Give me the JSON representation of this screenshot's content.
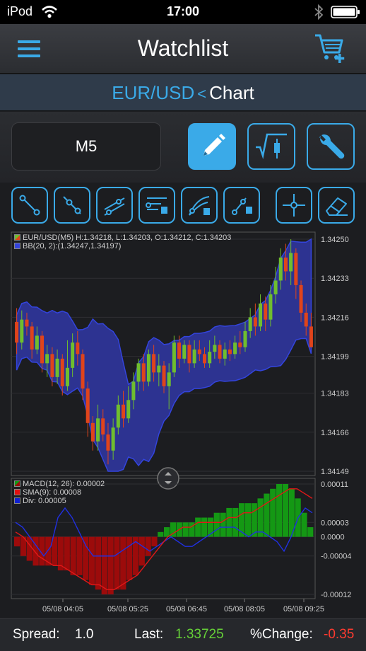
{
  "status": {
    "carrier": "iPod",
    "time": "17:00"
  },
  "nav": {
    "title": "Watchlist"
  },
  "subnav": {
    "symbol": "EUR/USD",
    "separator": "<",
    "page": "Chart"
  },
  "toolbar": {
    "timeframe": "M5"
  },
  "colors": {
    "accent": "#3aaae8",
    "bullish": "#6fbe2e",
    "bearish": "#e0441b",
    "band": "#2d3391",
    "band_edge": "#3344dd",
    "macd_bar_up": "#149814",
    "macd_bar_down": "#9c0b0b",
    "positive": "#66d138",
    "negative": "#ff3b30"
  },
  "icons": [
    "menu-icon",
    "cart-add-icon",
    "pencil-icon",
    "indicator-icon",
    "wrench-icon",
    "line-segment-icon",
    "ray-icon",
    "channel-icon",
    "fibonacci-retracement-icon",
    "fibonacci-fan-icon",
    "fibonacci-extension-icon",
    "crosshair-icon",
    "eraser-icon"
  ],
  "chart_data": [
    {
      "type": "candlestick",
      "legend": [
        "EUR/USD(M5) H:1.34218, L:1.34203, O:1.34212, C:1.34203",
        "BB(20, 2):(1.34247,1.34197)"
      ],
      "y_ticks": [
        "1.34250",
        "1.34233",
        "1.34216",
        "1.34199",
        "1.34183",
        "1.34166",
        "1.34149"
      ],
      "ylim": [
        1.34149,
        1.3425
      ],
      "candles": [
        [
          1.34214,
          1.34205,
          1.3422,
          1.342
        ],
        [
          1.34205,
          1.34215,
          1.34219,
          1.34202
        ],
        [
          1.34215,
          1.34212,
          1.34218,
          1.34208
        ],
        [
          1.34212,
          1.34202,
          1.34214,
          1.34198
        ],
        [
          1.34202,
          1.34208,
          1.34212,
          1.342
        ],
        [
          1.34208,
          1.34196,
          1.3421,
          1.34192
        ],
        [
          1.34196,
          1.342,
          1.34204,
          1.3419
        ],
        [
          1.342,
          1.3419,
          1.34203,
          1.34186
        ],
        [
          1.3419,
          1.34198,
          1.34202,
          1.34187
        ],
        [
          1.34198,
          1.34186,
          1.342,
          1.34182
        ],
        [
          1.34186,
          1.34194,
          1.34206,
          1.34184
        ],
        [
          1.34194,
          1.34205,
          1.34209,
          1.3419
        ],
        [
          1.34205,
          1.342,
          1.3421,
          1.34195
        ],
        [
          1.342,
          1.34185,
          1.34202,
          1.3418
        ],
        [
          1.34185,
          1.3417,
          1.34188,
          1.34164
        ],
        [
          1.3417,
          1.34162,
          1.34173,
          1.34158
        ],
        [
          1.34162,
          1.34172,
          1.34178,
          1.34158
        ],
        [
          1.34172,
          1.34165,
          1.34176,
          1.34162
        ],
        [
          1.34165,
          1.34158,
          1.3417,
          1.34152
        ],
        [
          1.34158,
          1.34168,
          1.34172,
          1.34154
        ],
        [
          1.34168,
          1.34178,
          1.34182,
          1.34165
        ],
        [
          1.34178,
          1.34172,
          1.34184,
          1.34168
        ],
        [
          1.34172,
          1.3418,
          1.34186,
          1.3417
        ],
        [
          1.3418,
          1.34188,
          1.34192,
          1.34176
        ],
        [
          1.34188,
          1.34196,
          1.34198,
          1.34184
        ],
        [
          1.34196,
          1.34188,
          1.342,
          1.34184
        ],
        [
          1.34188,
          1.342,
          1.34202,
          1.34186
        ],
        [
          1.342,
          1.34192,
          1.34204,
          1.34188
        ],
        [
          1.34192,
          1.34195,
          1.342,
          1.34186
        ],
        [
          1.34195,
          1.34186,
          1.34197,
          1.34183
        ],
        [
          1.34186,
          1.34192,
          1.34196,
          1.34176
        ],
        [
          1.34192,
          1.34205,
          1.34208,
          1.3419
        ],
        [
          1.34205,
          1.34198,
          1.34208,
          1.34194
        ],
        [
          1.34198,
          1.34204,
          1.34206,
          1.34196
        ],
        [
          1.34204,
          1.34196,
          1.34206,
          1.34192
        ],
        [
          1.34196,
          1.34202,
          1.34206,
          1.34194
        ],
        [
          1.34202,
          1.342,
          1.34206,
          1.34197
        ],
        [
          1.342,
          1.34196,
          1.34203,
          1.34194
        ],
        [
          1.34196,
          1.34201,
          1.34206,
          1.34194
        ],
        [
          1.34201,
          1.34204,
          1.34208,
          1.34198
        ],
        [
          1.34204,
          1.34198,
          1.34206,
          1.34196
        ],
        [
          1.34198,
          1.34202,
          1.34205,
          1.34195
        ],
        [
          1.34202,
          1.342,
          1.34206,
          1.34197
        ],
        [
          1.342,
          1.34205,
          1.34208,
          1.34198
        ],
        [
          1.34205,
          1.34203,
          1.3421,
          1.342
        ],
        [
          1.34203,
          1.3421,
          1.34214,
          1.34201
        ],
        [
          1.3421,
          1.34216,
          1.3422,
          1.34207
        ],
        [
          1.34216,
          1.34212,
          1.34222,
          1.34208
        ],
        [
          1.34212,
          1.34222,
          1.34226,
          1.3421
        ],
        [
          1.34222,
          1.34215,
          1.34225,
          1.3421
        ],
        [
          1.34215,
          1.34226,
          1.3423,
          1.34212
        ],
        [
          1.34226,
          1.34232,
          1.34238,
          1.34222
        ],
        [
          1.34232,
          1.34242,
          1.34246,
          1.34228
        ],
        [
          1.34242,
          1.34236,
          1.34248,
          1.34232
        ],
        [
          1.34236,
          1.34244,
          1.3425,
          1.3423
        ],
        [
          1.34244,
          1.3423,
          1.34246,
          1.34224
        ],
        [
          1.3423,
          1.34218,
          1.34232,
          1.34214
        ],
        [
          1.34218,
          1.34212,
          1.34222,
          1.34208
        ],
        [
          1.34212,
          1.34203,
          1.34218,
          1.34203
        ]
      ]
    },
    {
      "type": "bar+line",
      "legend": [
        "MACD(12, 26): 0.00002",
        "SMA(9): 0.00008",
        "Div: 0.00005"
      ],
      "y_ticks": [
        "0.00011",
        "0.00003",
        "0.0000",
        "-0.00004",
        "-0.00012"
      ],
      "ylim": [
        -0.00012,
        0.00011
      ],
      "x_ticks": [
        "05/08 04:05",
        "05/08 05:25",
        "05/08 06:45",
        "05/08 08:05",
        "05/08 09:25"
      ],
      "macd": [
        -2e-05,
        -4e-05,
        -5e-05,
        -6e-05,
        -6e-05,
        -6e-05,
        -6e-05,
        -7e-05,
        -7e-05,
        -8e-05,
        -8e-05,
        -9e-05,
        -0.0001,
        -0.00011,
        -0.00012,
        -0.00012,
        -0.00011,
        -0.00011,
        -9e-05,
        -8e-05,
        -6e-05,
        -4e-05,
        -2e-05,
        1e-05,
        2e-05,
        3e-05,
        3e-05,
        3e-05,
        3e-05,
        4e-05,
        4e-05,
        4e-05,
        5e-05,
        5e-05,
        6e-05,
        6e-05,
        7e-05,
        7e-05,
        7e-05,
        8e-05,
        9e-05,
        0.0001,
        0.00011,
        0.00011,
        0.0001,
        8e-05,
        5e-05,
        2e-05
      ],
      "sma": [
        1e-05,
        0.0,
        -2e-05,
        -4e-05,
        -5e-05,
        -6e-05,
        -6e-05,
        -7e-05,
        -8e-05,
        -9e-05,
        -0.0001,
        -0.0001,
        -0.00011,
        -0.00011,
        -0.0001,
        -9e-05,
        -8e-05,
        -6e-05,
        -4e-05,
        -2e-05,
        0.0,
        1e-05,
        2e-05,
        2e-05,
        3e-05,
        3e-05,
        3e-05,
        3e-05,
        4e-05,
        4e-05,
        5e-05,
        5e-05,
        6e-05,
        7e-05,
        8e-05,
        9e-05,
        0.0001,
        0.0001,
        9e-05,
        8e-05
      ],
      "div": [
        3e-05,
        2e-05,
        0.0,
        -2e-05,
        -4e-05,
        -2e-05,
        4e-05,
        6e-05,
        4e-05,
        1e-05,
        -2e-05,
        -4e-05,
        -4e-05,
        -4e-05,
        -4e-05,
        -3e-05,
        -2e-05,
        -1e-05,
        -2e-05,
        -3e-05,
        -2e-05,
        -1e-05,
        0.0,
        -1e-05,
        -2e-05,
        -2e-05,
        -1e-05,
        0.0,
        1e-05,
        2e-05,
        2e-05,
        2e-05,
        1e-05,
        0.0,
        1e-05,
        1e-05,
        0.0,
        -1e-05,
        -3e-05,
        0.0,
        4e-05,
        6e-05,
        5e-05
      ]
    }
  ],
  "footer": {
    "spread_label": "Spread:",
    "spread_value": "1.0",
    "last_label": "Last:",
    "last_value": "1.33725",
    "change_label": "%Change:",
    "change_value": "-0.35"
  }
}
